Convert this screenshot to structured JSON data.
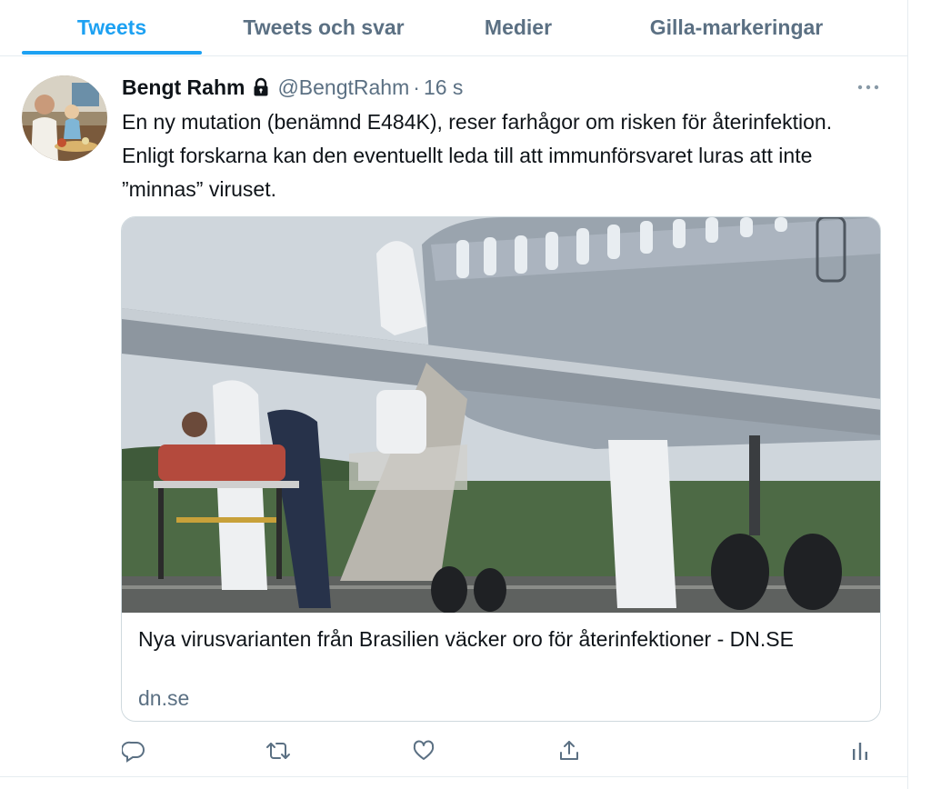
{
  "tabs": [
    {
      "label": "Tweets",
      "active": true
    },
    {
      "label": "Tweets och svar",
      "active": false
    },
    {
      "label": "Medier",
      "active": false
    },
    {
      "label": "Gilla-markeringar",
      "active": false
    }
  ],
  "tweet": {
    "author_name": "Bengt Rahm",
    "handle": "@BengtRahm",
    "separator": "·",
    "timestamp": "16 s",
    "protected_icon": "lock-icon",
    "text": "En ny mutation (benämnd E484K), reser farhågor om risken för återinfektion. Enligt forskarna kan den eventuellt leda till att immunförsvaret luras att inte ”minnas” viruset.",
    "card": {
      "title": "Nya virusvarianten från Brasilien väcker oro för återinfektioner - DN.SE",
      "domain": "dn.se"
    },
    "actions": [
      "reply-icon",
      "retweet-icon",
      "like-icon",
      "share-icon",
      "analytics-icon"
    ]
  },
  "colors": {
    "accent": "#1da1f2",
    "secondary_text": "#5b7083",
    "border": "#e6ecf0"
  }
}
